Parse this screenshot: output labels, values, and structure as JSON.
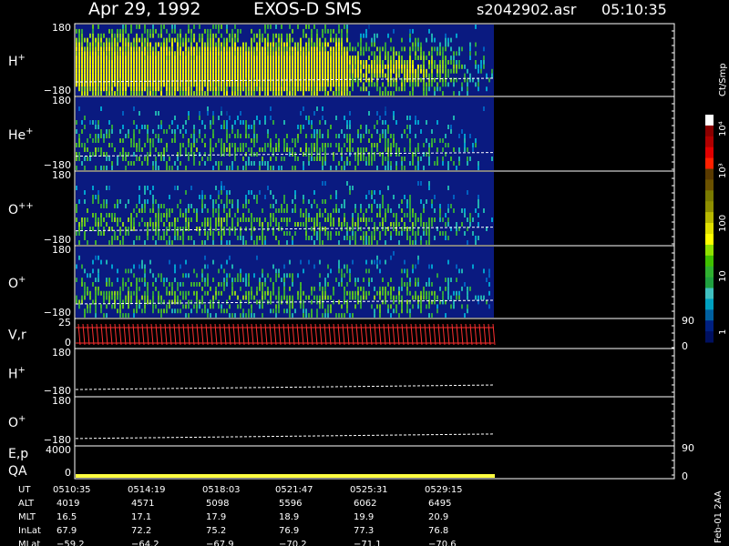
{
  "header": {
    "date": "Apr 29, 1992",
    "instrument": "EXOS-D SMS",
    "file": "s2042902.asr",
    "time": "05:10:35"
  },
  "panels": [
    {
      "label": "H",
      "sup": "+",
      "top": "180",
      "bottom": "−180",
      "type": "spectrogram",
      "intensity": 1.0
    },
    {
      "label": "He",
      "sup": "+",
      "top": "180",
      "bottom": "−180",
      "type": "spectrogram",
      "intensity": 0.55
    },
    {
      "label": "O",
      "sup": "++",
      "top": "180",
      "bottom": "−180",
      "type": "spectrogram",
      "intensity": 0.6
    },
    {
      "label": "O",
      "sup": "+",
      "top": "180",
      "bottom": "−180",
      "type": "spectrogram",
      "intensity": 0.6
    },
    {
      "label": "V,r",
      "sup": "",
      "top": "25",
      "bottom": "0",
      "right_top": "90",
      "right_bottom": "0",
      "type": "vr"
    },
    {
      "label": "H",
      "sup": "+",
      "top": "180",
      "bottom": "−180",
      "type": "line"
    },
    {
      "label": "O",
      "sup": "+",
      "top": "180",
      "bottom": "−180",
      "type": "line"
    },
    {
      "label": "E,p",
      "label2": "QA",
      "sup": "",
      "top": "4000",
      "bottom": "0",
      "right_top": "90",
      "right_bottom": "0",
      "type": "ep"
    }
  ],
  "colorbar": {
    "unit": "Ct/Smp",
    "ticks": [
      "10⁴",
      "10³",
      "100",
      "10",
      "1"
    ],
    "colors": [
      "#ffffff",
      "#8b0000",
      "#b00000",
      "#e00000",
      "#ff2000",
      "#5a3a00",
      "#6b5200",
      "#7a7a00",
      "#8f8f00",
      "#b8b800",
      "#e0e000",
      "#ffff00",
      "#90e000",
      "#40c000",
      "#30b030",
      "#20a040",
      "#40c0c0",
      "#00a0c0",
      "#0060a0",
      "#002080",
      "#001060"
    ]
  },
  "side_label": "Feb-01 2AA",
  "chart_data": {
    "type": "heatmap",
    "x_ticks": [
      "0510:35",
      "0514:19",
      "0518:03",
      "0521:47",
      "0525:31",
      "0529:15"
    ],
    "rows": [
      {
        "label": "UT",
        "values": [
          "0510:35",
          "0514:19",
          "0518:03",
          "0521:47",
          "0525:31",
          "0529:15"
        ]
      },
      {
        "label": "ALT",
        "values": [
          "4019",
          "4571",
          "5098",
          "5596",
          "6062",
          "6495"
        ]
      },
      {
        "label": "MLT",
        "values": [
          "16.5",
          "17.1",
          "17.9",
          "18.9",
          "19.9",
          "20.9"
        ]
      },
      {
        "label": "InLat",
        "values": [
          "67.9",
          "72.2",
          "75.2",
          "76.9",
          "77.3",
          "76.8"
        ]
      },
      {
        "label": "MLat",
        "values": [
          "−59.2",
          "−64.2",
          "−67.9",
          "−70.2",
          "−71.1",
          "−70.6"
        ]
      }
    ],
    "ylabel_range": [
      -180,
      180
    ],
    "grid": false
  }
}
